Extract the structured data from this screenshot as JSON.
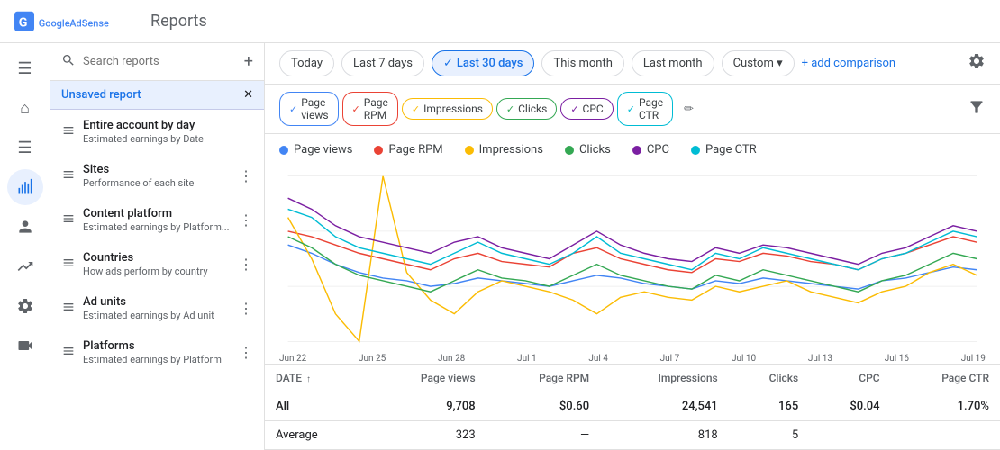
{
  "topbar": {
    "title": "Reports",
    "logo_alt": "Google AdSense"
  },
  "toolbar": {
    "today_label": "Today",
    "last7_label": "Last 7 days",
    "last30_label": "Last 30 days",
    "this_month_label": "This month",
    "last_month_label": "Last month",
    "custom_label": "Custom",
    "add_comparison_label": "+ add comparison",
    "active_tab": "last30"
  },
  "filter_chips": [
    {
      "id": "page-views",
      "label": "Page views",
      "color": "#4285f4"
    },
    {
      "id": "page-rpm",
      "label": "Page RPM",
      "color": "#ea4335"
    },
    {
      "id": "impressions",
      "label": "Impressions",
      "color": "#fbbc04"
    },
    {
      "id": "clicks",
      "label": "Clicks",
      "color": "#34a853"
    },
    {
      "id": "cpc",
      "label": "CPC",
      "color": "#7b1fa2"
    },
    {
      "id": "page-ctr",
      "label": "Page CTR",
      "color": "#00bcd4"
    }
  ],
  "legend": [
    {
      "label": "Page views",
      "color": "#4285f4"
    },
    {
      "label": "Page RPM",
      "color": "#ea4335"
    },
    {
      "label": "Impressions",
      "color": "#fbbc04"
    },
    {
      "label": "Clicks",
      "color": "#34a853"
    },
    {
      "label": "CPC",
      "color": "#7b1fa2"
    },
    {
      "label": "Page CTR",
      "color": "#00bcd4"
    }
  ],
  "x_axis_labels": [
    "Jun 22",
    "Jun 25",
    "Jun 28",
    "Jul 1",
    "Jul 4",
    "Jul 7",
    "Jul 10",
    "Jul 13",
    "Jul 16",
    "Jul 19"
  ],
  "table": {
    "columns": [
      {
        "id": "date",
        "label": "DATE",
        "sort": "asc"
      },
      {
        "id": "page_views",
        "label": "Page views"
      },
      {
        "id": "page_rpm",
        "label": "Page RPM"
      },
      {
        "id": "impressions",
        "label": "Impressions"
      },
      {
        "id": "clicks",
        "label": "Clicks"
      },
      {
        "id": "cpc",
        "label": "CPC"
      },
      {
        "id": "page_ctr",
        "label": "Page CTR"
      }
    ],
    "rows": [
      {
        "type": "all",
        "date": "All",
        "page_views": "9,708",
        "page_rpm": "$0.60",
        "impressions": "24,541",
        "clicks": "165",
        "cpc": "$0.04",
        "page_ctr": "1.70%"
      },
      {
        "type": "average",
        "date": "Average",
        "page_views": "323",
        "page_rpm": "—",
        "impressions": "818",
        "clicks": "5",
        "cpc": "",
        "page_ctr": ""
      }
    ]
  },
  "sidebar": {
    "search_placeholder": "Search reports",
    "unsaved_label": "Unsaved report",
    "items": [
      {
        "id": "entire-account",
        "title": "Entire account by day",
        "subtitle": "Estimated earnings by Date",
        "has_more": false
      },
      {
        "id": "sites",
        "title": "Sites",
        "subtitle": "Performance of each site",
        "has_more": true
      },
      {
        "id": "content-platform",
        "title": "Content platform",
        "subtitle": "Estimated earnings by Platform...",
        "has_more": true
      },
      {
        "id": "countries",
        "title": "Countries",
        "subtitle": "How ads perform by country",
        "has_more": true
      },
      {
        "id": "ad-units",
        "title": "Ad units",
        "subtitle": "Estimated earnings by Ad unit",
        "has_more": true
      },
      {
        "id": "platforms",
        "title": "Platforms",
        "subtitle": "Estimated earnings by Platform",
        "has_more": true
      }
    ]
  },
  "nav_icons": [
    "☰",
    "🏠",
    "📄",
    "📊",
    "👤",
    "📈",
    "⚙",
    "🎬"
  ],
  "chart": {
    "lines": [
      {
        "id": "page-views",
        "color": "#4285f4",
        "points": [
          55,
          52,
          48,
          45,
          43,
          42,
          40,
          41,
          43,
          42,
          41,
          40,
          42,
          44,
          43,
          41,
          40,
          39,
          42,
          41,
          43,
          42,
          41,
          40,
          39,
          42,
          43,
          45,
          47,
          46
        ]
      },
      {
        "id": "page-rpm",
        "color": "#ea4335",
        "points": [
          60,
          58,
          55,
          52,
          50,
          48,
          46,
          50,
          52,
          49,
          48,
          47,
          52,
          54,
          50,
          48,
          46,
          45,
          50,
          49,
          52,
          51,
          49,
          48,
          46,
          50,
          52,
          55,
          58,
          56
        ]
      },
      {
        "id": "impressions",
        "color": "#fbbc04",
        "points": [
          65,
          50,
          30,
          20,
          80,
          45,
          35,
          30,
          38,
          42,
          40,
          38,
          35,
          30,
          36,
          38,
          36,
          35,
          40,
          38,
          40,
          42,
          38,
          36,
          34,
          38,
          40,
          45,
          48,
          44
        ]
      },
      {
        "id": "clicks",
        "color": "#34a853",
        "points": [
          58,
          54,
          48,
          44,
          42,
          40,
          38,
          42,
          46,
          43,
          42,
          40,
          44,
          48,
          44,
          42,
          40,
          39,
          44,
          42,
          46,
          44,
          42,
          40,
          38,
          42,
          44,
          48,
          52,
          50
        ]
      },
      {
        "id": "cpc",
        "color": "#7b1fa2",
        "points": [
          72,
          68,
          62,
          58,
          56,
          54,
          52,
          56,
          58,
          54,
          52,
          50,
          55,
          60,
          55,
          52,
          50,
          49,
          54,
          52,
          55,
          54,
          52,
          50,
          48,
          52,
          54,
          58,
          62,
          60
        ]
      },
      {
        "id": "page-ctr",
        "color": "#00bcd4",
        "points": [
          68,
          65,
          58,
          54,
          52,
          50,
          48,
          52,
          56,
          52,
          50,
          48,
          52,
          58,
          52,
          50,
          48,
          46,
          52,
          50,
          54,
          52,
          50,
          48,
          46,
          50,
          52,
          56,
          60,
          58
        ]
      }
    ]
  }
}
